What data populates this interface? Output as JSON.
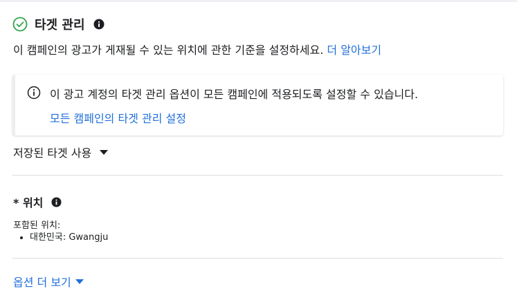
{
  "header": {
    "title": "타겟 관리",
    "icon": "check-circle-icon",
    "info_icon": "info-icon"
  },
  "description": {
    "text": "이 캠페인의 광고가 게재될 수 있는 위치에 관한 기준을 설정하세요.",
    "link": "더 알아보기"
  },
  "notice": {
    "icon": "info-outline-icon",
    "text": "이 광고 계정의 타겟 관리 옵션이 모든 캠페인에 적용되도록 설정할 수 있습니다.",
    "link": "모든 캠페인의 타겟 관리 설정"
  },
  "saved_targets": {
    "label": "저장된 타겟 사용",
    "icon": "caret-down-icon"
  },
  "location": {
    "title": "* 위치",
    "included_label": "포함된 위치:",
    "items": [
      "대한민국: Gwangju"
    ]
  },
  "more_options": {
    "label": "옵션 더 보기",
    "icon": "caret-down-icon"
  },
  "colors": {
    "link": "#216fdb",
    "text": "#1c1e21",
    "success": "#42b72a",
    "divider": "#dadde1"
  }
}
